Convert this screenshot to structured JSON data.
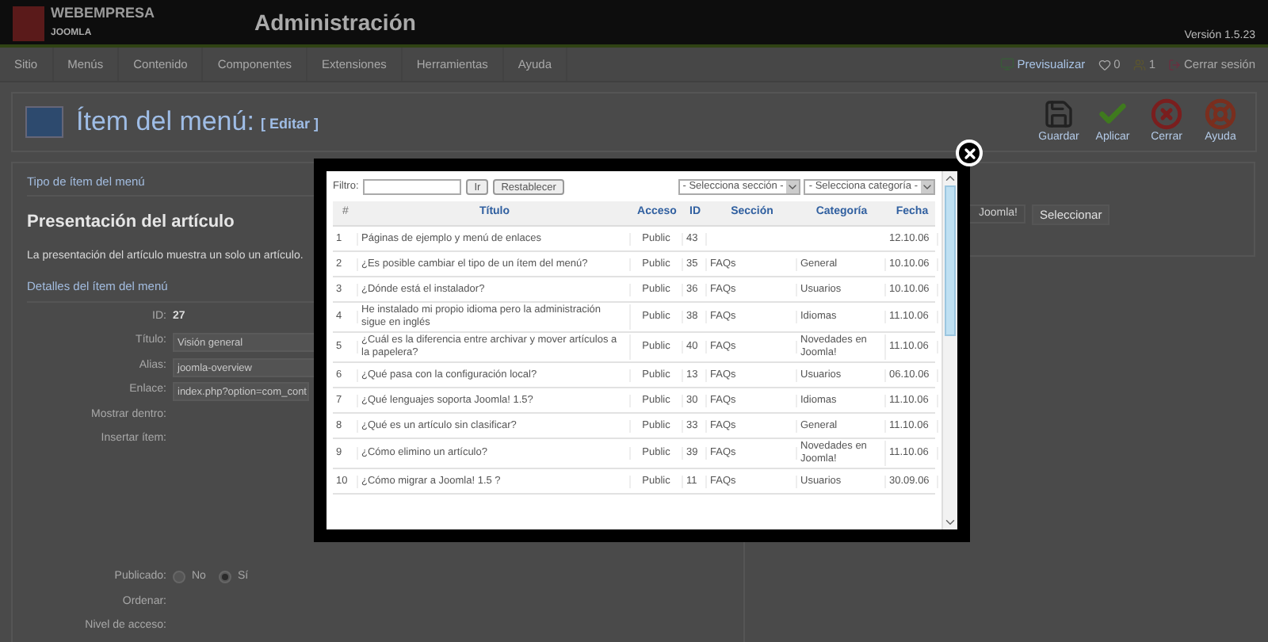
{
  "header": {
    "brand": "WEBEMPRESA",
    "brand_sub": "JOOMLA",
    "title": "Administración",
    "version": "Versión 1.5.23"
  },
  "menu": [
    "Sitio",
    "Menús",
    "Contenido",
    "Componentes",
    "Extensiones",
    "Herramientas",
    "Ayuda"
  ],
  "status": {
    "preview": "Previsualizar",
    "messages": "0",
    "users": "1",
    "logout": "Cerrar sesión"
  },
  "toolbar": {
    "title": "Ítem del menú:",
    "subtitle": "[ Editar ]",
    "buttons": [
      {
        "kind": "save",
        "label": "Guardar"
      },
      {
        "kind": "apply",
        "label": "Aplicar"
      },
      {
        "kind": "close",
        "label": "Cerrar"
      },
      {
        "kind": "help",
        "label": "Ayuda"
      }
    ]
  },
  "type_section": {
    "legend": "Tipo de ítem del menú",
    "heading": "Presentación del artículo",
    "description": "La presentación del artículo muestra un solo un artículo."
  },
  "details": {
    "legend": "Detalles del ítem del menú",
    "fields": [
      {
        "kind": "text",
        "label": "ID:",
        "value": "27"
      },
      {
        "kind": "input",
        "label": "Título:",
        "value": "Visión general"
      },
      {
        "kind": "input",
        "label": "Alias:",
        "value": "joomla-overview"
      },
      {
        "kind": "input",
        "label": "Enlace:",
        "value": "index.php?option=com_cont"
      },
      {
        "kind": "empty",
        "label": "Mostrar dentro:"
      },
      {
        "kind": "tall",
        "label": "Insertar ítem:"
      },
      {
        "kind": "radio",
        "label": "Publicado:",
        "options": [
          {
            "label": "No",
            "selected": false
          },
          {
            "label": "Sí",
            "selected": true
          }
        ]
      },
      {
        "kind": "empty",
        "label": "Ordenar:"
      },
      {
        "kind": "empty",
        "label": "Nivel de acceso:"
      }
    ]
  },
  "right_panel": {
    "value": "Joomla!",
    "button": "Seleccionar"
  },
  "modal": {
    "filter_label": "Filtro:",
    "go": "Ir",
    "reset": "Restablecer",
    "section_select": "- Selecciona sección -",
    "category_select": "- Selecciona categoría -",
    "columns": [
      "#",
      "Título",
      "Acceso",
      "ID",
      "Sección",
      "Categoría",
      "Fecha"
    ],
    "rows": [
      [
        "1",
        "Páginas de ejemplo y menú de enlaces",
        "Public",
        "43",
        "",
        "",
        "12.10.06"
      ],
      [
        "2",
        "¿Es posible cambiar el tipo de un ítem del menú?",
        "Public",
        "35",
        "FAQs",
        "General",
        "10.10.06"
      ],
      [
        "3",
        "¿Dónde está el instalador?",
        "Public",
        "36",
        "FAQs",
        "Usuarios",
        "10.10.06"
      ],
      [
        "4",
        "He instalado mi propio idioma pero la administración sigue en inglés",
        "Public",
        "38",
        "FAQs",
        "Idiomas",
        "11.10.06"
      ],
      [
        "5",
        "¿Cuál es la diferencia entre archivar y mover artículos a la papelera?",
        "Public",
        "40",
        "FAQs",
        "Novedades en Joomla!",
        "11.10.06"
      ],
      [
        "6",
        "¿Qué pasa con la configuración local?",
        "Public",
        "13",
        "FAQs",
        "Usuarios",
        "06.10.06"
      ],
      [
        "7",
        "¿Qué lenguajes soporta Joomla! 1.5?",
        "Public",
        "30",
        "FAQs",
        "Idiomas",
        "11.10.06"
      ],
      [
        "8",
        "¿Qué es un artículo sin clasificar?",
        "Public",
        "33",
        "FAQs",
        "General",
        "11.10.06"
      ],
      [
        "9",
        "¿Cómo elimino un artículo?",
        "Public",
        "39",
        "FAQs",
        "Novedades en Joomla!",
        "11.10.06"
      ],
      [
        "10",
        "¿Cómo migrar a Joomla! 1.5 ?",
        "Public",
        "11",
        "FAQs",
        "Usuarios",
        "30.09.06"
      ]
    ]
  }
}
